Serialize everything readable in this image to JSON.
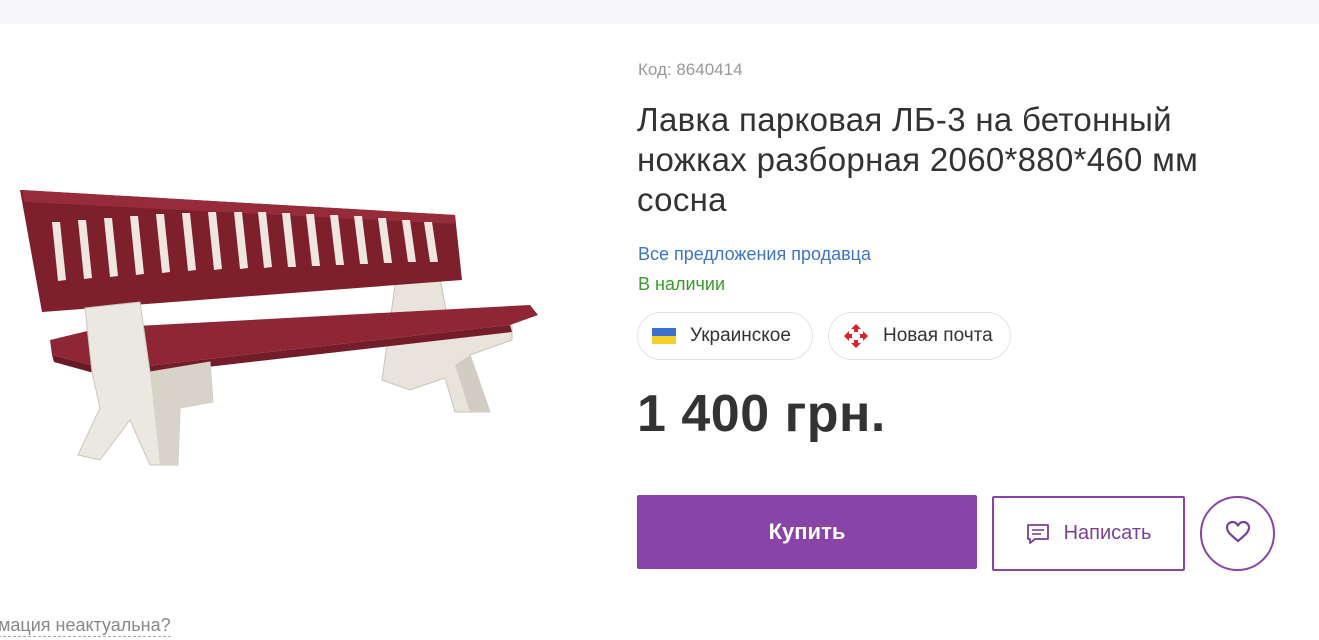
{
  "product": {
    "code": "Код: 8640414",
    "title": "Лавка парковая ЛБ-3 на бетонный ножках разборная 2060*880*460 мм сосна",
    "seller_link": "Все предложения продавца",
    "availability": "В наличии",
    "price": "1 400 грн.",
    "image_icon": "bench-image"
  },
  "badges": {
    "ukrainian": "Украинское",
    "delivery": "Новая почта"
  },
  "actions": {
    "buy_label": "Купить",
    "write_label": "Написать",
    "favorite_icon": "heart-icon"
  },
  "footer": {
    "report_text": "омация неактуальна?"
  },
  "colors": {
    "accent": "#8a44a8",
    "link": "#3f74c4",
    "in_stock": "#3a9a2a"
  }
}
